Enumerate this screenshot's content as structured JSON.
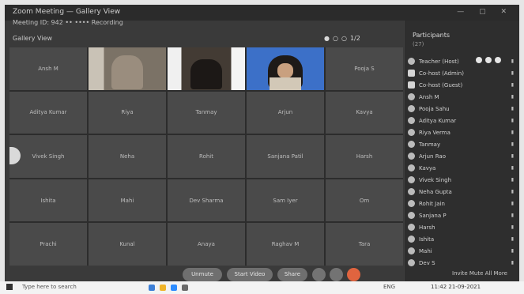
{
  "window": {
    "title": "Zoom Meeting — Gallery View",
    "meeting_info": "Meeting ID: 942 •• •••• Recording"
  },
  "stage": {
    "view_label": "Gallery View",
    "pager": [
      "●",
      "○",
      "○",
      "1/2"
    ]
  },
  "tiles": [
    {
      "name": "Ansh M"
    },
    {
      "name": "",
      "video": "a"
    },
    {
      "name": "",
      "video": "b"
    },
    {
      "name": "",
      "video": "c"
    },
    {
      "name": "Pooja S"
    },
    {
      "name": "Aditya Kumar"
    },
    {
      "name": "Riya"
    },
    {
      "name": "Tanmay"
    },
    {
      "name": "Arjun"
    },
    {
      "name": "Kavya"
    },
    {
      "name": "Vivek Singh"
    },
    {
      "name": "Neha"
    },
    {
      "name": "Rohit"
    },
    {
      "name": "Sanjana Patil"
    },
    {
      "name": "Harsh"
    },
    {
      "name": "Ishita"
    },
    {
      "name": "Mahi"
    },
    {
      "name": "Dev Sharma"
    },
    {
      "name": "Sam Iyer"
    },
    {
      "name": "Om"
    },
    {
      "name": "Prachi"
    },
    {
      "name": "Kunal"
    },
    {
      "name": "Anaya"
    },
    {
      "name": "Raghav M"
    },
    {
      "name": "Tara"
    }
  ],
  "toolbar": {
    "mute_label": "Unmute",
    "video_label": "Start Video",
    "share_label": "Share"
  },
  "participants": {
    "title": "Participants",
    "subtitle": "(27)",
    "rows": [
      {
        "name": "Teacher (Host)",
        "host": true
      },
      {
        "name": "Co-host (Admin)",
        "square": true
      },
      {
        "name": "Co-host (Guest)",
        "square": true
      },
      {
        "name": "Ansh M"
      },
      {
        "name": "Pooja Sahu"
      },
      {
        "name": "Aditya Kumar"
      },
      {
        "name": "Riya Verma"
      },
      {
        "name": "Tanmay"
      },
      {
        "name": "Arjun Rao"
      },
      {
        "name": "Kavya"
      },
      {
        "name": "Vivek Singh"
      },
      {
        "name": "Neha Gupta"
      },
      {
        "name": "Rohit Jain"
      },
      {
        "name": "Sanjana P"
      },
      {
        "name": "Harsh"
      },
      {
        "name": "Ishita"
      },
      {
        "name": "Mahi"
      },
      {
        "name": "Dev S"
      }
    ],
    "footer": "Invite   Mute All   More"
  },
  "taskbar": {
    "search_text": "Type here to search",
    "tray_text": "ENG",
    "clock": "11:42  21-09-2021"
  }
}
